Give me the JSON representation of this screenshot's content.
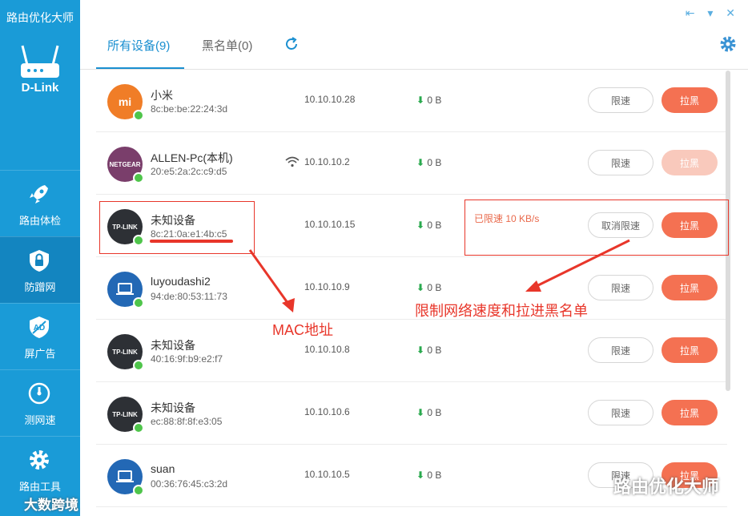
{
  "app": {
    "title": "路由优化大师",
    "brand": "D-Link"
  },
  "window_controls": "⇤ ▾ ✕",
  "sidebar": {
    "items": [
      {
        "label": "路由体检",
        "icon": "rocket-icon"
      },
      {
        "label": "防蹭网",
        "icon": "shield-lock-icon"
      },
      {
        "label": "屏广告",
        "icon": "ad-block-icon"
      },
      {
        "label": "测网速",
        "icon": "speedometer-icon"
      },
      {
        "label": "路由工具",
        "icon": "gear-icon"
      }
    ]
  },
  "tabs": [
    {
      "label": "所有设备(9)"
    },
    {
      "label": "黑名单(0)"
    }
  ],
  "devices": [
    {
      "name": "小米",
      "mac": "8c:be:be:22:24:3d",
      "ip": "10.10.10.28",
      "download": "0 B",
      "limit_label": "限速",
      "block_label": "拉黑",
      "avatar_text": "mi",
      "avatar_color": "#f07d27"
    },
    {
      "name": "ALLEN-Pc(本机)",
      "mac": "20:e5:2a:2c:c9:d5",
      "ip": "10.10.10.2",
      "download": "0 B",
      "limit_label": "限速",
      "block_label": "拉黑",
      "avatar_text": "NETGEAR",
      "avatar_color": "#7a3e6b"
    },
    {
      "name": "未知设备",
      "mac": "8c:21:0a:e1:4b:c5",
      "ip": "10.10.10.15",
      "download": "0 B",
      "limit_status": "已限速 10 KB/s",
      "limit_label": "取消限速",
      "block_label": "拉黑",
      "avatar_text": "TP-LINK",
      "avatar_color": "#2d3035"
    },
    {
      "name": "luyoudashi2",
      "mac": "94:de:80:53:11:73",
      "ip": "10.10.10.9",
      "download": "0 B",
      "limit_label": "限速",
      "block_label": "拉黑",
      "avatar_text": "",
      "avatar_color": "#2368b5"
    },
    {
      "name": "未知设备",
      "mac": "40:16:9f:b9:e2:f7",
      "ip": "10.10.10.8",
      "download": "0 B",
      "limit_label": "限速",
      "block_label": "拉黑",
      "avatar_text": "TP-LINK",
      "avatar_color": "#2d3035"
    },
    {
      "name": "未知设备",
      "mac": "ec:88:8f:8f:e3:05",
      "ip": "10.10.10.6",
      "download": "0 B",
      "limit_label": "限速",
      "block_label": "拉黑",
      "avatar_text": "TP-LINK",
      "avatar_color": "#2d3035"
    },
    {
      "name": "suan",
      "mac": "00:36:76:45:c3:2d",
      "ip": "10.10.10.5",
      "download": "0 B",
      "limit_label": "限速",
      "block_label": "拉黑",
      "avatar_text": "",
      "avatar_color": "#2368b5"
    }
  ],
  "annotations": {
    "mac": "MAC地址",
    "limit": "限制网络速度和拉进黑名单"
  },
  "watermarks": {
    "left": "大数跨境",
    "right": "路由优化大师"
  },
  "colors": {
    "sidebar": "#1a9bd7",
    "accent": "#1a8fd0",
    "block": "#f47152",
    "annotation": "#e8362a"
  }
}
